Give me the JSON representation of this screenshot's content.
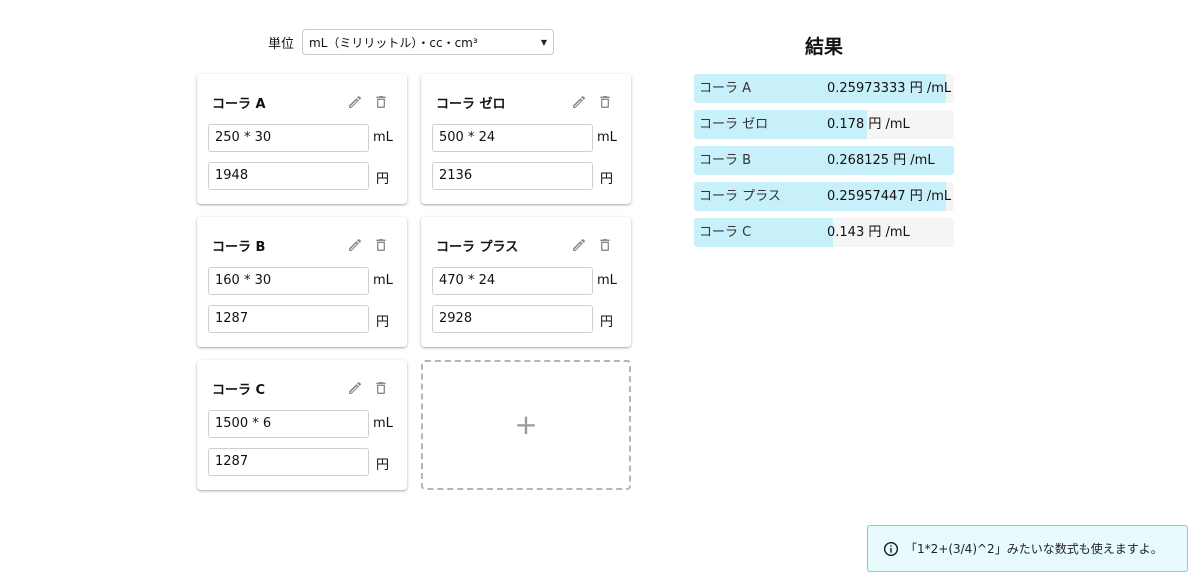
{
  "unit": {
    "label": "単位",
    "selected": "mL（ミリリットル）・cc・cm³"
  },
  "cards": [
    {
      "name": "コーラ A",
      "volume": "250 * 30",
      "volume_unit": "mL",
      "price": "1948",
      "price_unit": "円"
    },
    {
      "name": "コーラ ゼロ",
      "volume": "500 * 24",
      "volume_unit": "mL",
      "price": "2136",
      "price_unit": "円"
    },
    {
      "name": "コーラ B",
      "volume": "160 * 30",
      "volume_unit": "mL",
      "price": "1287",
      "price_unit": "円"
    },
    {
      "name": "コーラ プラス",
      "volume": "470 * 24",
      "volume_unit": "mL",
      "price": "2928",
      "price_unit": "円"
    },
    {
      "name": "コーラ C",
      "volume": "1500 * 6",
      "volume_unit": "mL",
      "price": "1287",
      "price_unit": "円"
    }
  ],
  "add_card": {
    "symbol": "+"
  },
  "results": {
    "title": "結果",
    "rows": [
      {
        "name": "コーラ A",
        "value": "0.25973333 円 /mL",
        "bar_ratio": 0.969
      },
      {
        "name": "コーラ ゼロ",
        "value": "0.178 円 /mL",
        "bar_ratio": 0.664
      },
      {
        "name": "コーラ B",
        "value": "0.268125 円 /mL",
        "bar_ratio": 1.0
      },
      {
        "name": "コーラ プラス",
        "value": "0.25957447 円 /mL",
        "bar_ratio": 0.968
      },
      {
        "name": "コーラ C",
        "value": "0.143 円 /mL",
        "bar_ratio": 0.533
      }
    ],
    "bar_color": "#c8f0fb"
  },
  "toast": {
    "message": "「1*2+(3/4)^2」みたいな数式も使えますよ。",
    "border_color": "#6fd3e4"
  },
  "icons": {
    "edit": "pencil-icon",
    "delete": "trash-icon",
    "info": "info-icon"
  }
}
